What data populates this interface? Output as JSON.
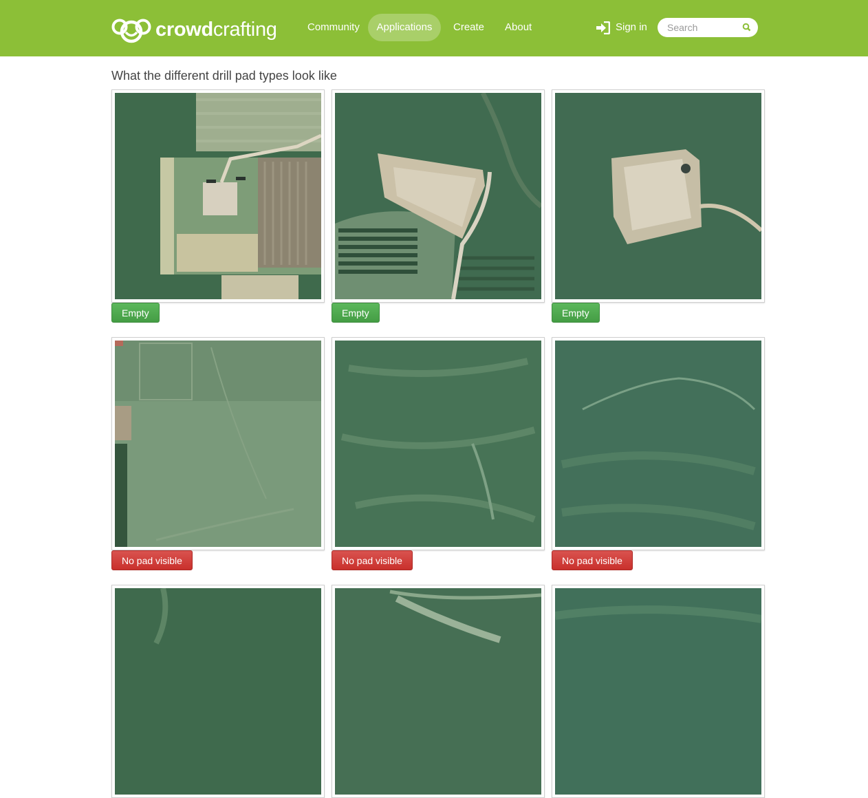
{
  "brand": {
    "bold": "crowd",
    "light": "crafting"
  },
  "nav": {
    "community": "Community",
    "applications": "Applications",
    "create": "Create",
    "about": "About",
    "signin": "Sign in",
    "search_placeholder": "Search"
  },
  "icons": {
    "signin": "sign-in-icon",
    "search": "search-icon",
    "logo": "crowdcrafting-logo"
  },
  "colors": {
    "navbar": "#8cbf37",
    "empty_button": "#5cb85c",
    "no_pad_button": "#d9534f"
  },
  "page": {
    "heading": "What the different drill pad types look like"
  },
  "examples": [
    {
      "label": "Empty",
      "kind": "empty"
    },
    {
      "label": "Empty",
      "kind": "empty"
    },
    {
      "label": "Empty",
      "kind": "empty"
    },
    {
      "label": "No pad visible",
      "kind": "no-pad"
    },
    {
      "label": "No pad visible",
      "kind": "no-pad"
    },
    {
      "label": "No pad visible",
      "kind": "no-pad"
    },
    {
      "kind": "forest"
    },
    {
      "kind": "forest"
    },
    {
      "kind": "forest"
    }
  ]
}
